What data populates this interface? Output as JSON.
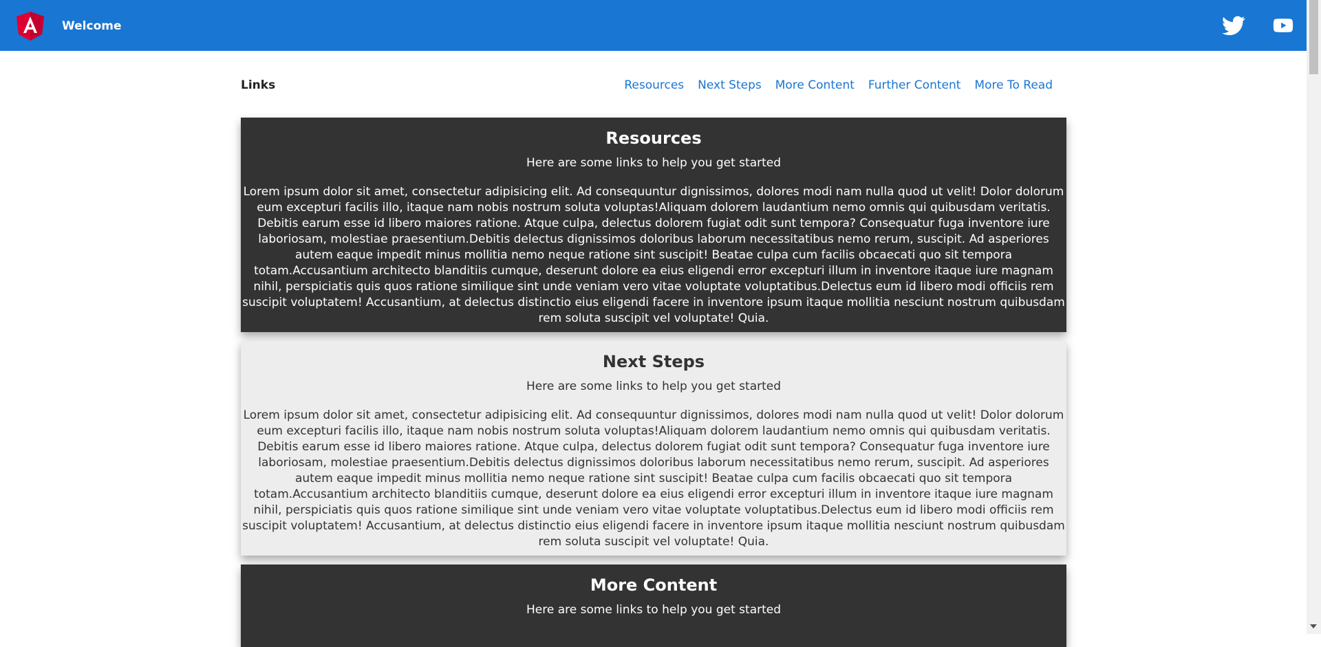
{
  "toolbar": {
    "title": "Welcome",
    "colors": {
      "background": "#1976d2",
      "logo": "#dd0031"
    },
    "icons": [
      "angular-logo-icon",
      "twitter-icon",
      "youtube-icon"
    ]
  },
  "links": {
    "title": "Links",
    "nav": [
      "Resources",
      "Next Steps",
      "More Content",
      "Further Content",
      "More To Read"
    ]
  },
  "cards": [
    {
      "title": "Resources",
      "subtitle": "Here are some links to help you get started",
      "body": "Lorem ipsum dolor sit amet, consectetur adipisicing elit. Ad consequuntur dignissimos, dolores modi nam nulla quod ut velit! Dolor dolorum eum excepturi facilis illo, itaque nam nobis nostrum soluta voluptas!Aliquam dolorem laudantium nemo omnis qui quibusdam veritatis. Debitis earum esse id libero maiores ratione. Atque culpa, delectus dolorem fugiat odit sunt tempora? Consequatur fuga inventore iure laboriosam, molestiae praesentium.Debitis delectus dignissimos doloribus laborum necessitatibus nemo rerum, suscipit. Ad asperiores autem eaque impedit minus mollitia nemo neque ratione sint suscipit! Beatae culpa cum facilis obcaecati quo sit tempora totam.Accusantium architecto blanditiis cumque, deserunt dolore ea eius eligendi error excepturi illum in inventore itaque iure magnam nihil, perspiciatis quis quos ratione similique sint unde veniam vero vitae voluptate voluptatibus.Delectus eum id libero modi officiis rem suscipit voluptatem! Accusantium, at delectus distinctio eius eligendi facere in inventore ipsum itaque mollitia nesciunt nostrum quibusdam rem soluta suscipit vel voluptate! Quia."
    },
    {
      "title": "Next Steps",
      "subtitle": "Here are some links to help you get started",
      "body": "Lorem ipsum dolor sit amet, consectetur adipisicing elit. Ad consequuntur dignissimos, dolores modi nam nulla quod ut velit! Dolor dolorum eum excepturi facilis illo, itaque nam nobis nostrum soluta voluptas!Aliquam dolorem laudantium nemo omnis qui quibusdam veritatis. Debitis earum esse id libero maiores ratione. Atque culpa, delectus dolorem fugiat odit sunt tempora? Consequatur fuga inventore iure laboriosam, molestiae praesentium.Debitis delectus dignissimos doloribus laborum necessitatibus nemo rerum, suscipit. Ad asperiores autem eaque impedit minus mollitia nemo neque ratione sint suscipit! Beatae culpa cum facilis obcaecati quo sit tempora totam.Accusantium architecto blanditiis cumque, deserunt dolore ea eius eligendi error excepturi illum in inventore itaque iure magnam nihil, perspiciatis quis quos ratione similique sint unde veniam vero vitae voluptate voluptatibus.Delectus eum id libero modi officiis rem suscipit voluptatem! Accusantium, at delectus distinctio eius eligendi facere in inventore ipsum itaque mollitia nesciunt nostrum quibusdam rem soluta suscipit vel voluptate! Quia."
    },
    {
      "title": "More Content",
      "subtitle": "Here are some links to help you get started"
    }
  ],
  "colors": {
    "dark_card": "#333333",
    "light_card": "#ededed",
    "link": "#1976d2"
  }
}
